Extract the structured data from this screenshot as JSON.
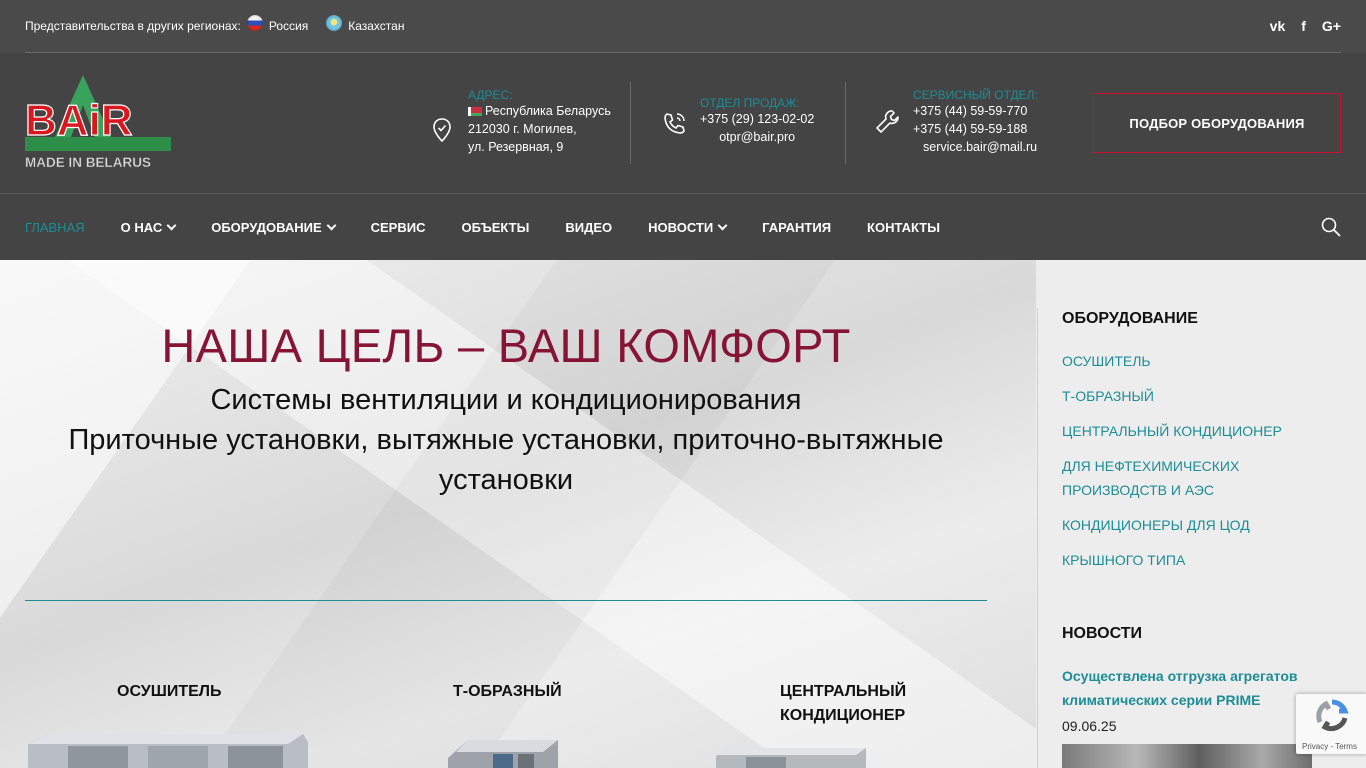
{
  "topbar": {
    "regions_label": "Представительства в других регионах:",
    "regions": [
      {
        "name": "Россия",
        "flag": "russia-flag-icon"
      },
      {
        "name": "Казахстан",
        "flag": "kazakhstan-flag-icon"
      }
    ],
    "social": [
      {
        "name": "vk-icon",
        "glyph": "vk"
      },
      {
        "name": "facebook-icon",
        "glyph": "f"
      },
      {
        "name": "google-plus-icon",
        "glyph": "G+"
      }
    ]
  },
  "header": {
    "logo_text": "BAiR",
    "logo_tagline": "MADE IN BELARUS",
    "address": {
      "label": "АДРЕС:",
      "lines": [
        "Республика Беларусь",
        "212030 г. Могилев,",
        "ул. Резервная, 9"
      ]
    },
    "sales": {
      "label": "ОТДЕЛ ПРОДАЖ:",
      "lines": [
        "+375 (29) 123-02-02",
        "otpr@bair.pro"
      ]
    },
    "service": {
      "label": "СЕРВИСНЫЙ ОТДЕЛ:",
      "lines": [
        "+375 (44) 59-59-770",
        "+375 (44) 59-59-188",
        "service.bair@mail.ru"
      ]
    },
    "pick_button": "ПОДБОР ОБОРУДОВАНИЯ"
  },
  "nav": {
    "items": [
      {
        "label": "ГЛАВНАЯ",
        "active": true
      },
      {
        "label": "О НАС",
        "dropdown": true
      },
      {
        "label": "ОБОРУДОВАНИЕ",
        "dropdown": true
      },
      {
        "label": "СЕРВИС"
      },
      {
        "label": "ОБЪЕКТЫ"
      },
      {
        "label": "ВИДЕО"
      },
      {
        "label": "НОВОСТИ",
        "dropdown": true
      },
      {
        "label": "ГАРАНТИЯ"
      },
      {
        "label": "КОНТАКТЫ"
      }
    ]
  },
  "hero": {
    "title": "НАША ЦЕЛЬ – ВАШ КОМФОРТ",
    "subtitle_line1": "Системы вентиляции и кондиционирования",
    "subtitle_line2": "Приточные установки, вытяжные установки, приточно-вытяжные",
    "subtitle_line3": "установки"
  },
  "products": [
    {
      "title_line1": "ОСУШИТЕЛЬ",
      "title_line2": ""
    },
    {
      "title_line1": "Т-ОБРАЗНЫЙ",
      "title_line2": ""
    },
    {
      "title_line1": "ЦЕНТРАЛЬНЫЙ",
      "title_line2": "КОНДИЦИОНЕР"
    }
  ],
  "sidebar": {
    "equipment_heading": "ОБОРУДОВАНИЕ",
    "equipment_links": [
      "ОСУШИТЕЛЬ",
      "Т-ОБРАЗНЫЙ",
      "ЦЕНТРАЛЬНЫЙ КОНДИЦИОНЕР",
      "ДЛЯ НЕФТЕХИМИЧЕСКИХ",
      "ПРОИЗВОДСТВ И АЭС",
      "КОНДИЦИОНЕРЫ ДЛЯ ЦОД",
      "КРЫШНОГО ТИПА"
    ],
    "news_heading": "НОВОСТИ",
    "news": {
      "title": "Осуществлена отгрузка агрегатов климатических серии PRIME",
      "date": "09.06.25"
    }
  },
  "recaptcha": {
    "label": "Privacy - Terms"
  },
  "colors": {
    "accent": "#1d8d96",
    "brand_red": "#c8102e",
    "title_red": "#861434",
    "header_bg": "#444444"
  }
}
